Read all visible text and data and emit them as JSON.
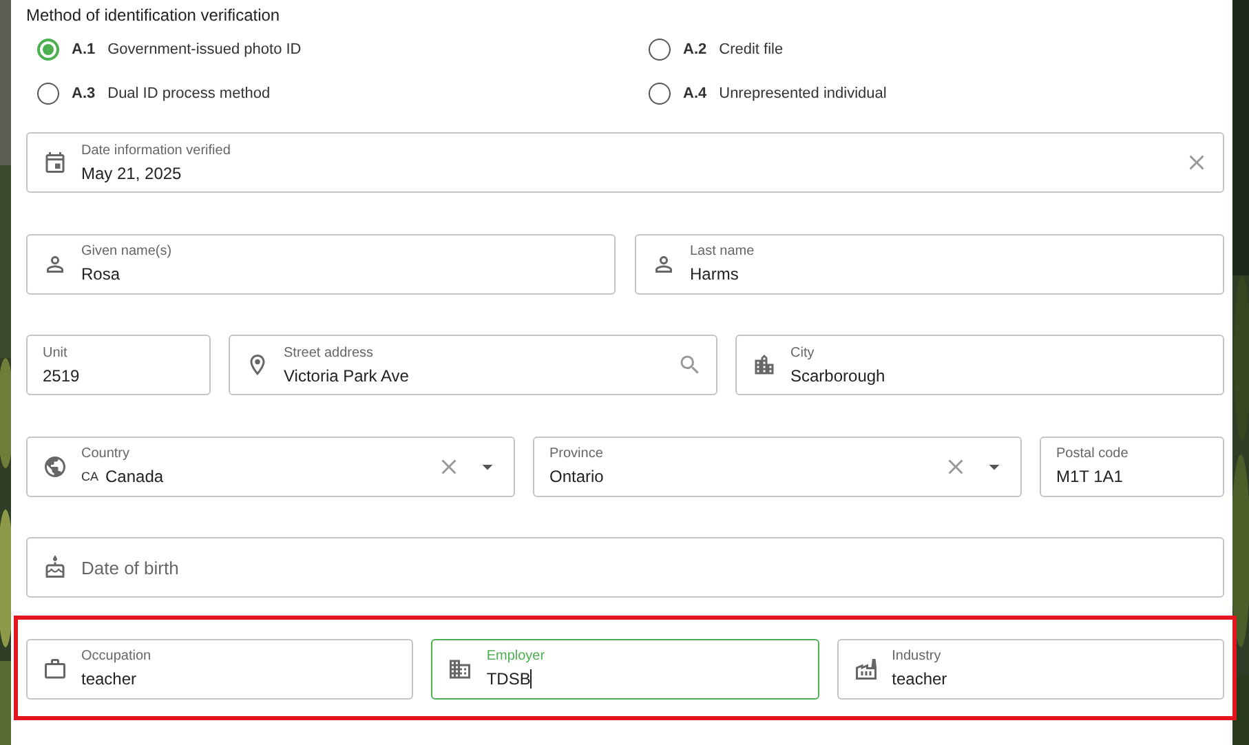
{
  "verification": {
    "title": "Method of identification verification",
    "options": [
      {
        "code": "A.1",
        "label": "Government-issued photo ID",
        "selected": true
      },
      {
        "code": "A.2",
        "label": "Credit file",
        "selected": false
      },
      {
        "code": "A.3",
        "label": "Dual ID process method",
        "selected": false
      },
      {
        "code": "A.4",
        "label": "Unrepresented individual",
        "selected": false
      }
    ]
  },
  "rows": [
    {
      "highlighted": false,
      "fields": [
        {
          "kind": "date",
          "label": "Date information verified",
          "value": "May 21, 2025",
          "focused": false
        }
      ]
    },
    {
      "highlighted": false,
      "fields": [
        {
          "kind": "person",
          "label": "Given name(s)",
          "value": "Rosa",
          "focused": false
        },
        {
          "kind": "person",
          "label": "Last name",
          "value": "Harms",
          "focused": false
        }
      ]
    },
    {
      "highlighted": false,
      "fields": [
        {
          "kind": "text",
          "label": "Unit",
          "value": "2519",
          "focused": false
        },
        {
          "kind": "address",
          "label": "Street address",
          "value": "Victoria Park Ave",
          "focused": false
        },
        {
          "kind": "city",
          "label": "City",
          "value": "Scarborough",
          "focused": false
        }
      ]
    },
    {
      "highlighted": false,
      "fields": [
        {
          "kind": "country",
          "label": "Country",
          "prefix": "CA",
          "value": "Canada",
          "focused": false
        },
        {
          "kind": "select",
          "label": "Province",
          "value": "Ontario",
          "focused": false
        },
        {
          "kind": "text",
          "label": "Postal code",
          "value": "M1T 1A1",
          "focused": false
        }
      ]
    },
    {
      "highlighted": false,
      "fields": [
        {
          "kind": "birthday",
          "placeholder": "Date of birth",
          "focused": false
        }
      ]
    },
    {
      "highlighted": true,
      "fields": [
        {
          "kind": "occupation",
          "label": "Occupation",
          "value": "teacher",
          "focused": false
        },
        {
          "kind": "employer",
          "label": "Employer",
          "value": "TDSB",
          "focused": true
        },
        {
          "kind": "industry",
          "label": "Industry",
          "value": "teacher",
          "focused": false
        }
      ]
    }
  ]
}
